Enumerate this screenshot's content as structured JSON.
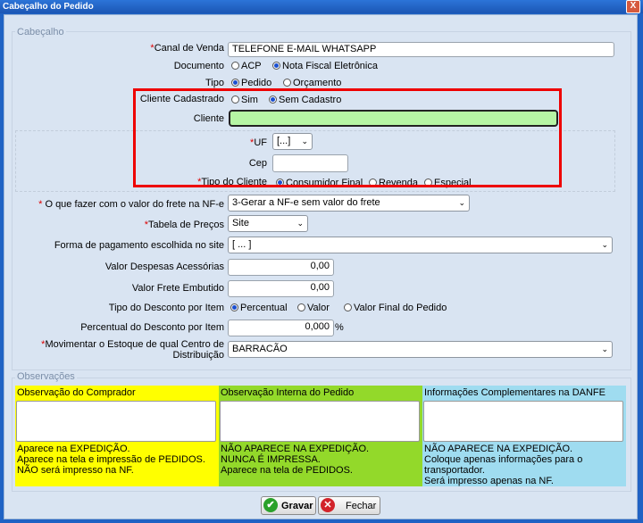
{
  "window": {
    "title": "Cabeçalho do Pedido",
    "close": "X"
  },
  "section_header": {
    "legend": "Cabeçalho"
  },
  "canal": {
    "label": "Canal de Venda",
    "value": "TELEFONE E-MAIL WHATSAPP"
  },
  "documento": {
    "label": "Documento",
    "opt1": "ACP",
    "opt2": "Nota Fiscal Eletrônica"
  },
  "tipo": {
    "label": "Tipo",
    "opt1": "Pedido",
    "opt2": "Orçamento"
  },
  "cliente_cadastrado": {
    "label": "Cliente Cadastrado",
    "opt1": "Sim",
    "opt2": "Sem Cadastro"
  },
  "cliente": {
    "label": "Cliente",
    "value": ""
  },
  "uf": {
    "label": "UF",
    "value": "[...]"
  },
  "cep": {
    "label": "Cep",
    "value": ""
  },
  "tipo_cliente": {
    "label": "Tipo do Cliente",
    "opt1": "Consumidor Final",
    "opt2": "Revenda",
    "opt3": "Especial"
  },
  "frete": {
    "label": "O que fazer com o valor do frete na NF-e",
    "value": "3-Gerar a NF-e sem valor do frete"
  },
  "tabela": {
    "label": "Tabela de Preços",
    "value": "Site"
  },
  "pagamento": {
    "label": "Forma de pagamento escolhida no site",
    "value": "[ ... ]"
  },
  "despesas": {
    "label": "Valor Despesas Acessórias",
    "value": "0,00"
  },
  "frete_embutido": {
    "label": "Valor Frete Embutido",
    "value": "0,00"
  },
  "tipo_desconto": {
    "label": "Tipo do Desconto por Item",
    "opt1": "Percentual",
    "opt2": "Valor",
    "opt3": "Valor Final do Pedido"
  },
  "perc_desconto": {
    "label": "Percentual do Desconto por Item",
    "value": "0,000",
    "unit": "%"
  },
  "estoque": {
    "label": "Movimentar o Estoque de qual Centro de Distribuição",
    "value": "BARRACÃO"
  },
  "observacoes": {
    "legend": "Observações"
  },
  "obs_comprador": {
    "title": "Observação do Comprador",
    "notes": [
      "Aparece na EXPEDIÇÃO.",
      "Aparece na tela e impressão de PEDIDOS.",
      "NÃO será impresso na NF."
    ]
  },
  "obs_interna": {
    "title": "Observação Interna do Pedido",
    "notes": [
      "NÃO APARECE NA EXPEDIÇÃO.",
      "NUNCA É IMPRESSA.",
      "Aparece na tela de PEDIDOS."
    ]
  },
  "obs_danfe": {
    "title": "Informações Complementares na DANFE",
    "notes": [
      "NÃO APARECE NA EXPEDIÇÃO.",
      "Coloque apenas informações para o transportador.",
      "Será impresso apenas na NF."
    ]
  },
  "buttons": {
    "save": "Gravar",
    "close": "Fechar"
  },
  "colors": {
    "yellow": "#ffff00",
    "green": "#93d92a",
    "cyan": "#9fdcf0",
    "client_field": "#b6f5a4",
    "highlight": "#e00000"
  }
}
